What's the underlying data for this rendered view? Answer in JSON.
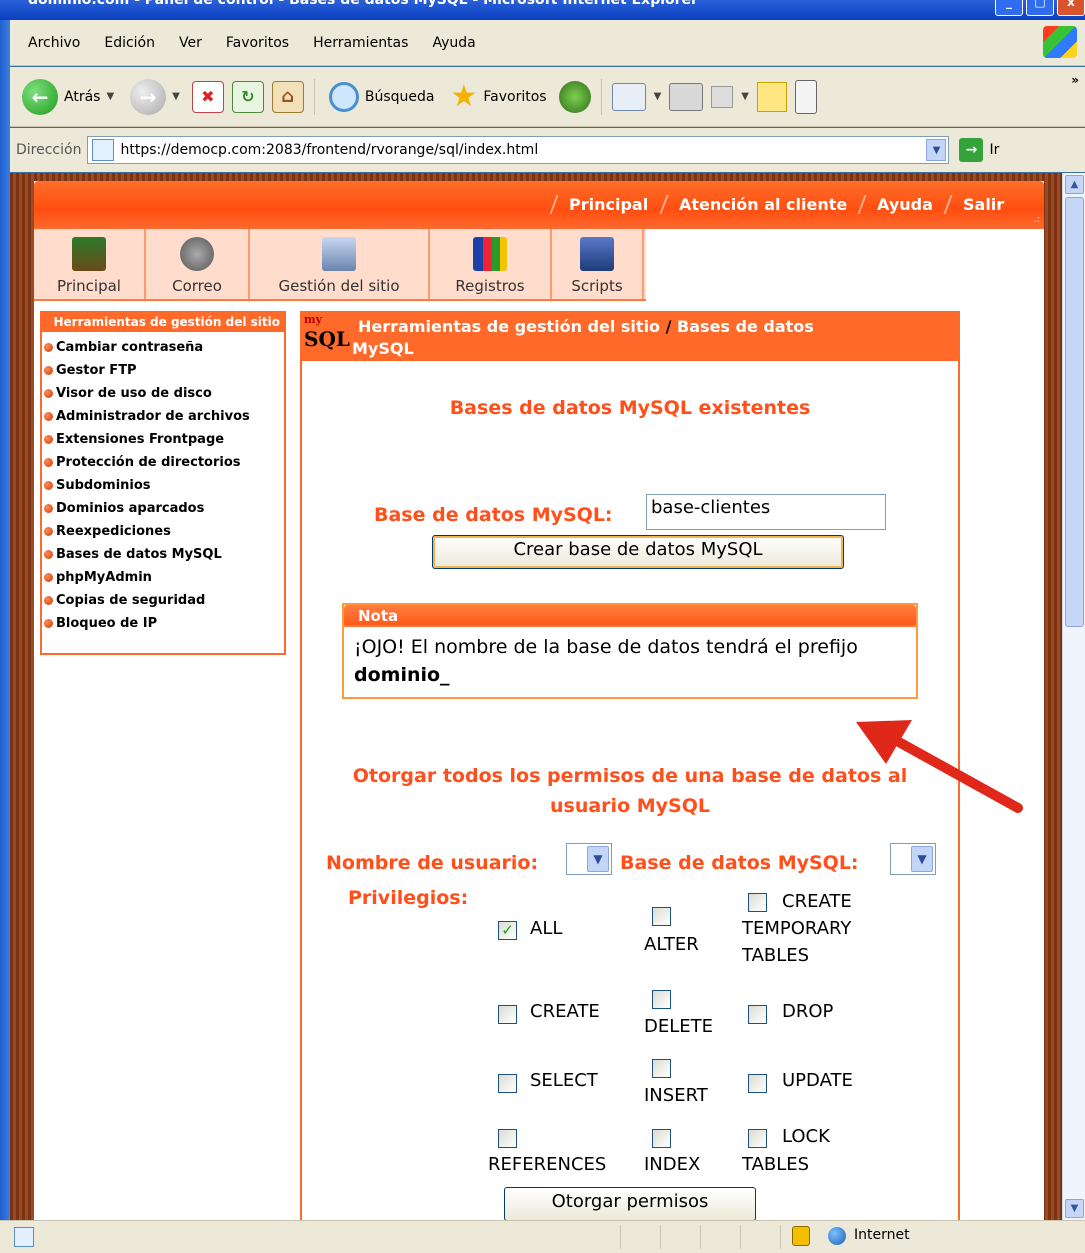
{
  "window": {
    "title": "dominio.com - Panel de control - Bases de datos MySQL - Microsoft Internet Explorer"
  },
  "menu": [
    "Archivo",
    "Edición",
    "Ver",
    "Favoritos",
    "Herramientas",
    "Ayuda"
  ],
  "toolbar": {
    "back_label": "Atrás",
    "search_label": "Búsqueda",
    "favorites_label": "Favoritos",
    "overflow": "»"
  },
  "address": {
    "label": "Dirección",
    "url": "https://democp.com:2083/frontend/rvorange/sql/index.html",
    "go_label": "Ir"
  },
  "topnav": [
    "Principal",
    "Atención al cliente",
    "Ayuda",
    "Salir"
  ],
  "iconbar": [
    "Principal",
    "Correo",
    "Gestión del sitio",
    "Registros",
    "Scripts"
  ],
  "sidebar": {
    "title": "Herramientas de gestión del sitio",
    "items": [
      "Cambiar contraseña",
      "Gestor FTP",
      "Visor de uso de disco",
      "Administrador de archivos",
      "Extensiones Frontpage",
      "Protección de directorios",
      "Subdominios",
      "Dominios aparcados",
      "Reexpediciones",
      "Bases de datos MySQL",
      "phpMyAdmin",
      "Copias de seguridad",
      "Bloqueo de IP"
    ]
  },
  "main": {
    "breadcrumb_1": "Herramientas de gestión del sitio",
    "breadcrumb_sep": "/",
    "breadcrumb_2": "Bases de datos",
    "breadcrumb_3": "MySQL",
    "logo_small": "my",
    "logo_big": "SQL",
    "existing_heading": "Bases de datos MySQL existentes",
    "db_label": "Base de datos MySQL:",
    "db_value": "base-clientes",
    "create_button": "Crear base de datos MySQL",
    "note_title": "Nota",
    "note_text": "¡OJO! El nombre de la base de datos tendrá el prefijo",
    "note_bold": "dominio_",
    "grant_heading_1": "Otorgar todos los permisos de una base de datos al",
    "grant_heading_2": "usuario MySQL",
    "user_label": "Nombre de usuario:",
    "db_label_2": "Base de datos MySQL:",
    "privileges_label": "Privilegios:",
    "privileges": {
      "all": "ALL",
      "alter": "ALTER",
      "create_temp_1": "CREATE",
      "create_temp_2": "TEMPORARY",
      "create_temp_3": "TABLES",
      "create": "CREATE",
      "delete": "DELETE",
      "drop": "DROP",
      "select": "SELECT",
      "insert": "INSERT",
      "update": "UPDATE",
      "references": "REFERENCES",
      "index": "INDEX",
      "lock_1": "LOCK",
      "lock_2": "TABLES"
    },
    "all_checked": true,
    "grant_button": "Otorgar permisos"
  },
  "status": {
    "zone": "Internet"
  },
  "colors": {
    "accent": "#ff6a2a",
    "heading": "#ff4f1a",
    "arrow": "#e0281a"
  }
}
